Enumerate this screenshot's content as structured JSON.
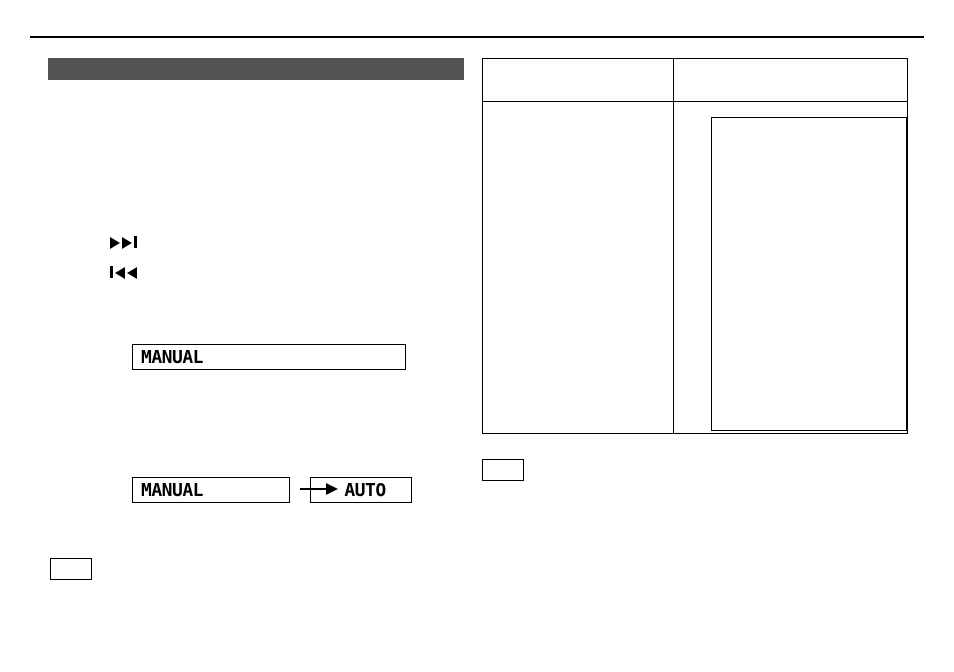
{
  "l1": "MANUAL",
  "l2": "MANUAL",
  "l3": "AUTO"
}
